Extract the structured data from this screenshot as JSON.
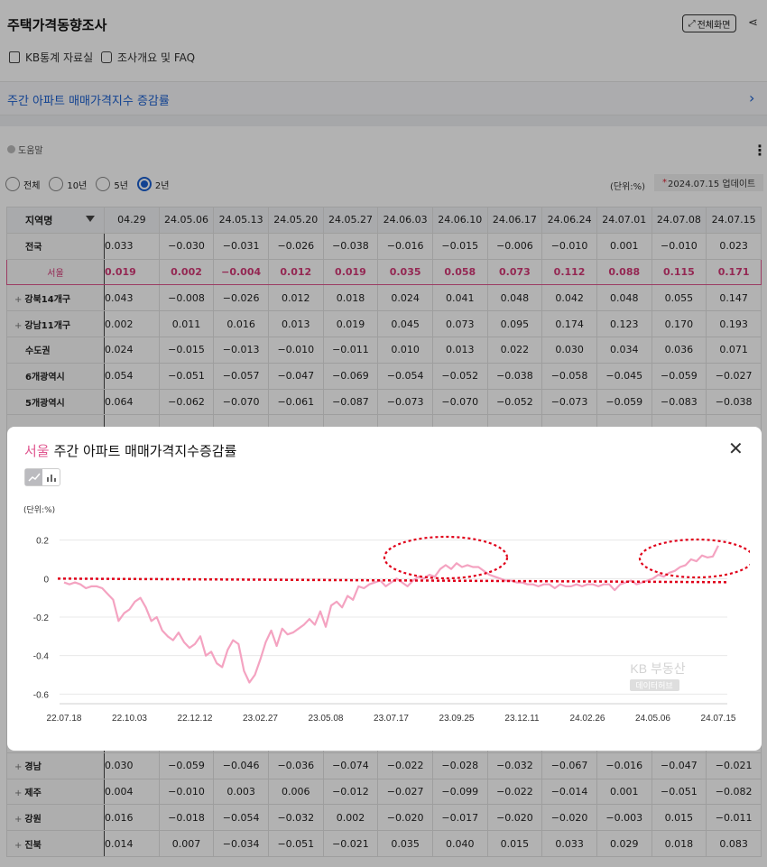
{
  "app": {
    "title": "주택가격동향조사",
    "fullscreen_label": "전체화면",
    "links": [
      "KB통계 자료실",
      "조사개요 및 FAQ"
    ]
  },
  "subheader": {
    "title": "주간 아파트 매매가격지수 증감률"
  },
  "help_label": "도움말",
  "period_options": [
    {
      "label": "전체",
      "selected": false
    },
    {
      "label": "10년",
      "selected": false
    },
    {
      "label": "5년",
      "selected": false
    },
    {
      "label": "2년",
      "selected": true
    }
  ],
  "unit_label": "(단위:%)",
  "update_label": "2024.07.15 업데이트",
  "table": {
    "region_header": "지역명",
    "columns": [
      "04.29",
      "24.05.06",
      "24.05.13",
      "24.05.20",
      "24.05.27",
      "24.06.03",
      "24.06.10",
      "24.06.17",
      "24.06.24",
      "24.07.01",
      "24.07.08",
      "24.07.15"
    ],
    "rows_top": [
      {
        "region": "전국",
        "expandable": false,
        "highlight": false,
        "values": [
          "0.033",
          "−0.030",
          "−0.031",
          "−0.026",
          "−0.038",
          "−0.016",
          "−0.015",
          "−0.006",
          "−0.010",
          "0.001",
          "−0.010",
          "0.023"
        ]
      },
      {
        "region": "서울",
        "expandable": false,
        "highlight": true,
        "values": [
          "0.019",
          "0.002",
          "−0.004",
          "0.012",
          "0.019",
          "0.035",
          "0.058",
          "0.073",
          "0.112",
          "0.088",
          "0.115",
          "0.171"
        ]
      },
      {
        "region": "강북14개구",
        "expandable": true,
        "highlight": false,
        "values": [
          "0.043",
          "−0.008",
          "−0.026",
          "0.012",
          "0.018",
          "0.024",
          "0.041",
          "0.048",
          "0.042",
          "0.048",
          "0.055",
          "0.147"
        ]
      },
      {
        "region": "강남11개구",
        "expandable": true,
        "highlight": false,
        "values": [
          "0.002",
          "0.011",
          "0.016",
          "0.013",
          "0.019",
          "0.045",
          "0.073",
          "0.095",
          "0.174",
          "0.123",
          "0.170",
          "0.193"
        ]
      },
      {
        "region": "수도권",
        "expandable": false,
        "highlight": false,
        "values": [
          "0.024",
          "−0.015",
          "−0.013",
          "−0.010",
          "−0.011",
          "0.010",
          "0.013",
          "0.022",
          "0.030",
          "0.034",
          "0.036",
          "0.071"
        ]
      },
      {
        "region": "6개광역시",
        "expandable": false,
        "highlight": false,
        "values": [
          "0.054",
          "−0.051",
          "−0.057",
          "−0.047",
          "−0.069",
          "−0.054",
          "−0.052",
          "−0.038",
          "−0.058",
          "−0.045",
          "−0.059",
          "−0.027"
        ]
      },
      {
        "region": "5개광역시",
        "expandable": false,
        "highlight": false,
        "values": [
          "0.064",
          "−0.062",
          "−0.070",
          "−0.061",
          "−0.087",
          "−0.073",
          "−0.070",
          "−0.052",
          "−0.073",
          "−0.059",
          "−0.083",
          "−0.038"
        ]
      }
    ],
    "rows_bottom": [
      {
        "region": "경남",
        "expandable": true,
        "highlight": false,
        "values": [
          "0.030",
          "−0.059",
          "−0.046",
          "−0.036",
          "−0.074",
          "−0.022",
          "−0.028",
          "−0.032",
          "−0.067",
          "−0.016",
          "−0.047",
          "−0.021"
        ]
      },
      {
        "region": "제주",
        "expandable": true,
        "highlight": false,
        "values": [
          "0.004",
          "−0.010",
          "0.003",
          "0.006",
          "−0.012",
          "−0.027",
          "−0.099",
          "−0.022",
          "−0.014",
          "0.001",
          "−0.051",
          "−0.082"
        ]
      },
      {
        "region": "강원",
        "expandable": true,
        "highlight": false,
        "values": [
          "0.016",
          "−0.018",
          "−0.054",
          "−0.032",
          "0.002",
          "−0.020",
          "−0.017",
          "−0.020",
          "−0.020",
          "−0.003",
          "0.015",
          "−0.011"
        ]
      },
      {
        "region": "진북",
        "expandable": true,
        "highlight": false,
        "values": [
          "0.014",
          "0.007",
          "−0.034",
          "−0.051",
          "−0.021",
          "0.035",
          "0.040",
          "0.015",
          "0.033",
          "0.029",
          "0.018",
          "0.083"
        ]
      }
    ]
  },
  "modal": {
    "city": "서울",
    "title": "주간 아파트 매매가격지수증감률",
    "unit_label": "(단위:%)",
    "watermark_line1": "KB 부동산",
    "watermark_line2": "데이터허브",
    "chart_type_icons": [
      "line-chart-icon",
      "bar-chart-icon"
    ]
  },
  "colors": {
    "accent_blue": "#1a5fd0",
    "highlight_pink": "#e0568f",
    "series_pink": "#f4a3c1",
    "annotation_red": "#e0001a"
  },
  "chart_data": {
    "type": "line",
    "x_tick_labels": [
      "22.07.18",
      "22.10.03",
      "22.12.12",
      "23.02.27",
      "23.05.08",
      "23.07.17",
      "23.09.25",
      "23.12.11",
      "24.02.26",
      "24.05.06",
      "24.07.15"
    ],
    "ylim": [
      -0.65,
      0.25
    ],
    "y_ticks": [
      0.2,
      0,
      -0.2,
      -0.4,
      -0.6
    ],
    "grid": "horizontal",
    "series": [
      {
        "values": [
          -0.02,
          -0.03,
          -0.02,
          -0.03,
          -0.05,
          -0.04,
          -0.04,
          -0.05,
          -0.08,
          -0.11,
          -0.22,
          -0.18,
          -0.16,
          -0.12,
          -0.1,
          -0.15,
          -0.22,
          -0.2,
          -0.27,
          -0.3,
          -0.32,
          -0.28,
          -0.33,
          -0.36,
          -0.34,
          -0.3,
          -0.4,
          -0.38,
          -0.44,
          -0.46,
          -0.37,
          -0.32,
          -0.34,
          -0.48,
          -0.54,
          -0.5,
          -0.42,
          -0.33,
          -0.27,
          -0.35,
          -0.26,
          -0.29,
          -0.28,
          -0.26,
          -0.24,
          -0.21,
          -0.24,
          -0.17,
          -0.25,
          -0.14,
          -0.12,
          -0.15,
          -0.09,
          -0.11,
          -0.04,
          -0.05,
          -0.03,
          -0.02,
          -0.01,
          -0.04,
          -0.02,
          0.0,
          -0.02,
          -0.04,
          -0.01,
          0.01,
          0.0,
          0.02,
          0.01,
          0.05,
          0.07,
          0.05,
          0.08,
          0.06,
          0.07,
          0.06,
          0.06,
          0.04,
          0.02,
          0.01,
          0.0,
          -0.01,
          -0.01,
          -0.02,
          -0.02,
          -0.03,
          -0.03,
          -0.04,
          -0.03,
          -0.03,
          -0.05,
          -0.03,
          -0.04,
          -0.04,
          -0.03,
          -0.04,
          -0.03,
          -0.03,
          -0.04,
          -0.03,
          -0.03,
          -0.06,
          -0.03,
          -0.02,
          -0.01,
          -0.03,
          -0.02,
          -0.01,
          0.0,
          0.02,
          0.01,
          0.03,
          0.04,
          0.06,
          0.07,
          0.1,
          0.09,
          0.12,
          0.11,
          0.115,
          0.171
        ]
      }
    ]
  }
}
